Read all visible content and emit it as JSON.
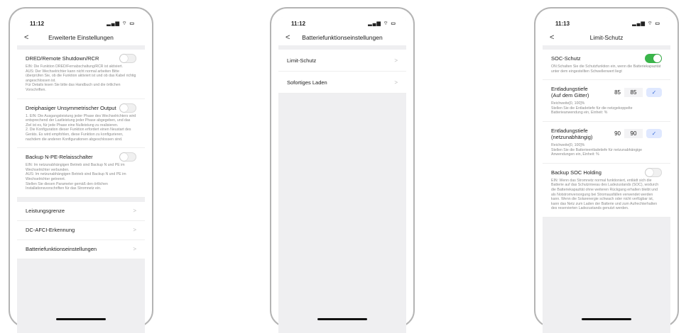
{
  "phone1": {
    "time": "11:12",
    "status_icons": "▂▄▆ ⌔ ▭",
    "back": "<",
    "title": "Erweiterte Einstellungen",
    "toggles": [
      {
        "title": "DRED/Remote Shutdown/RCR",
        "state": "off",
        "desc": "EIN: Die Funktion DRED/Fernabschaltung/RCR ist aktiviert.\nAUS: Der Wechselrichter kann nicht normal arbeiten Bitte überprüfen Sie, ob die Funktion aktiviert ist und ob das Kabel richtig angeschlossen ist.\nFür Details lesen Sie bitte das Handbuch und die örtlichen Vorschriften."
      },
      {
        "title": "Dreiphasiger Unsymmetrischer Output",
        "state": "off",
        "desc": "1. EIN: Die Ausgangsleistung jeder Phase des Wechselrichters wird entsprechend der Lastleistung jeder Phase abgegeben, und das Ziel ist es, für jede Phase eine Nulleistung zu realisieren.\n2. Die Konfiguration dieser Funktion erfordert einen Neustart des Geräts. Es wird empfohlen, diese Funktion zu konfigurieren, nachdem die anderen Konfigurationen abgeschlossen sind."
      },
      {
        "title": "Backup N-PE-Relaisschalter",
        "state": "off",
        "desc": "EIN: Im netzunabhängigen Betrieb sind Backup N und PE im Wechselrichter verbunden.\nAUS: Im netzunabhängigen Betrieb sind Backup N und PE im Wechselrichter getrennt.\nStellen Sie diesen Parameter gemäß den örtlichen Installationsvorschriften für das Stromnetz ein."
      }
    ],
    "nav_items": [
      "Leistungsgrenze",
      "DC-AFCI-Erkennung",
      "Batteriefunktionseinstellungen"
    ],
    "chevron": ">"
  },
  "phone2": {
    "time": "11:12",
    "status_icons": "▂▄▆ ⌔ ▭",
    "back": "<",
    "title": "Batteriefunktionseinstellungen",
    "nav_items": [
      "Limit-Schutz",
      "Sofortiges Laden"
    ],
    "chevron": ">"
  },
  "phone3": {
    "time": "11:13",
    "status_icons": "▂▄▆ ⌔ ▭",
    "back": "<",
    "title": "Limit-Schutz",
    "soc": {
      "title": "SOC-Schutz",
      "state": "on",
      "desc": "ON:Schalten Sie die Schutzfunktion ein, wenn die Batteriekapazität unter dem eingestellten Schwellenwert liegt"
    },
    "depth_grid": {
      "title": "Entladungstiefe\n(Auf dem Gitter)",
      "value": "85",
      "input": "85",
      "check": "✓",
      "desc": "Reichweite[0, 100]%\nStellen Sie die Entladetiefe für die netzgekoppelte Batterieanwendung ein, Einheit: %"
    },
    "depth_offgrid": {
      "title": "Entladungstiefe\n(netzunabhängig)",
      "value": "90",
      "input": "90",
      "check": "✓",
      "desc": "Reichweite[0, 100]%\nStellen Sie die Batterieentladetiefe für netzunabhängige Anwendungen ein, Einheit: %"
    },
    "backup": {
      "title": "Backup SOC Holding",
      "state": "off",
      "desc": "EIN: Wenn das Stromnetz normal funktioniert, entlädt sich die Batterie auf das Schutzniveau des Ladezustands (SOC), wodurch die Batteriekapazität ohne weiteren Rückgang erhalten bleibt und als Notstromversorgung bei Stromausfällen verwendet werden kann. Wenn die Solarenergie schwach oder nicht verfügbar ist, kann das Netz zum Laden der Batterie und zum Aufrechterhalten des reservierten Ladezustands genutzt werden."
    }
  },
  "colors": {
    "toggle_on": "#3ab54a",
    "accent_blue": "#3d6fd8"
  }
}
